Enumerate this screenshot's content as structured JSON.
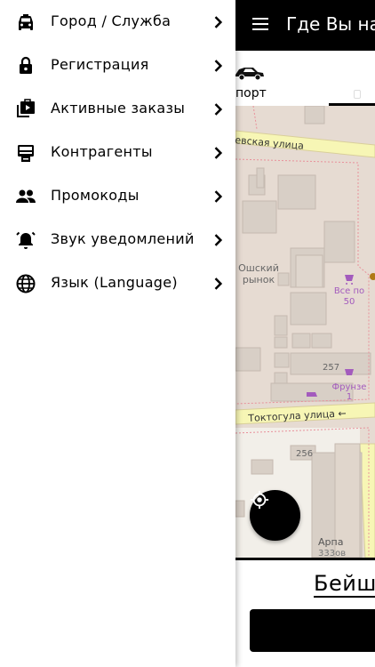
{
  "app": {
    "title": "Где Вы на",
    "transport_label": "порт",
    "address_text": "Бейш"
  },
  "drawer": {
    "items": [
      {
        "label": "Город / Служба",
        "icon": "taxi-icon"
      },
      {
        "label": "Регистрация",
        "icon": "lock-icon"
      },
      {
        "label": "Активные заказы",
        "icon": "video-library-icon"
      },
      {
        "label": "Контрагенты",
        "icon": "card-reader-icon"
      },
      {
        "label": "Промокоды",
        "icon": "people-icon"
      },
      {
        "label": "Звук уведомлений",
        "icon": "alarm-bell-icon"
      },
      {
        "label": "Язык (Language)",
        "icon": "globe-icon"
      }
    ]
  },
  "map": {
    "streets": {
      "street_top": "евская улица",
      "street_bottom": "Токтогула улица ←"
    },
    "labels": {
      "market": "Ошский рынок",
      "shop_1": "Все по 50",
      "house_257": "257",
      "shop_2": "Фрунзе 1",
      "house_256": "256",
      "arpa": "Арпа",
      "arpa_sub": "333ов"
    },
    "colors": {
      "land": "#e6dbd2",
      "street": "#f7f6b5",
      "building": "#d8cfc6",
      "poi": "#a35bbd"
    }
  },
  "colors": {
    "accent": "#000000",
    "background": "#ffffff"
  }
}
